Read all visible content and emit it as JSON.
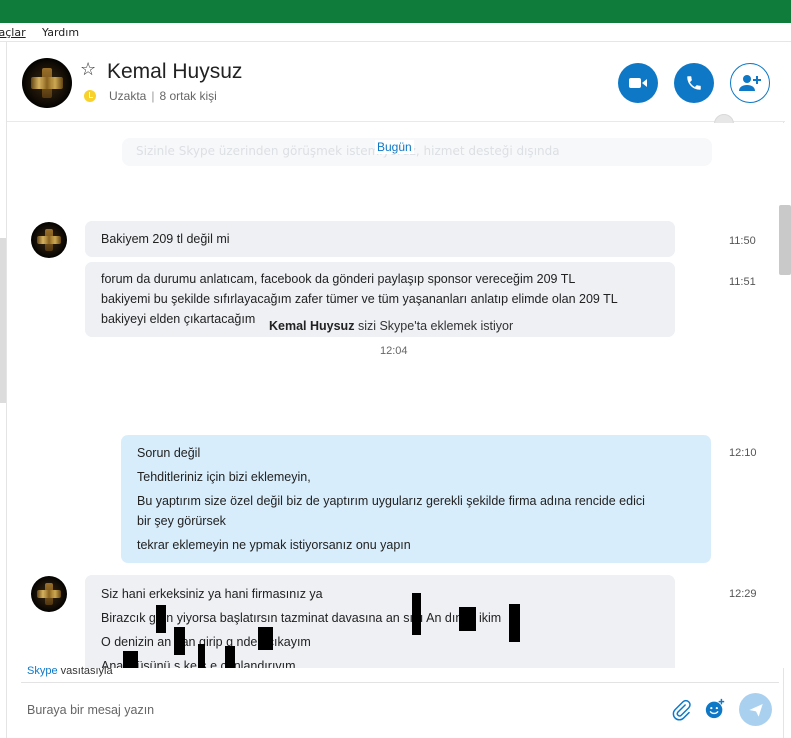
{
  "menu": {
    "item1": "raçlar",
    "item2": "Yardım"
  },
  "header": {
    "contact_name": "Kemal Huysuz",
    "status": "Uzakta",
    "mutual": "8 ortak kişi"
  },
  "chat": {
    "ghost_text": "Sizinle Skype üzerinden görüşmek istemiyoruz, hizmet desteği dışında",
    "today_label": "Bugün",
    "messages": [
      {
        "id": "m1",
        "text": "Bakiyem 209 tl değil mi",
        "time": "11:50"
      },
      {
        "id": "m2",
        "lines": [
          "forum da durumu anlatıcam, facebook da gönderi paylaşıp sponsor vereceğim 209 TL",
          "bakiyemi bu şekilde sıfırlayacağım zafer tümer ve tüm yaşananları anlatıp elimde olan 209 TL",
          "bakiyeyi elden çıkartacağım"
        ],
        "time": "11:51"
      },
      {
        "id": "m4",
        "lines": [
          "Sorun değil",
          "Tehditleriniz için bizi eklemeyin,",
          "Bu yaptırım size özel değil biz de yaptırım uygularız gerekli şekilde firma adına rencide edici",
          "bir şey görürsek",
          "tekrar eklemeyin ne ypmak istiyorsanız onu yapın"
        ],
        "time": "12:10"
      },
      {
        "id": "m5",
        "lines": [
          "Siz hani erkeksiniz ya hani firmasınız ya",
          "Birazcık g    ün yiyorsa başlatırsın tazminat davasına an    sını An    dını s   ikim",
          "O denizin an    dan girip g      nden çıkayım",
          "Ana    ölüsünü s  ke s   e canlandırıvım"
        ],
        "time": "12:29"
      }
    ],
    "system": {
      "name": "Kemal Huysuz",
      "text": "sizi Skype'ta eklemek istiyor",
      "time": "12:04"
    }
  },
  "footer": {
    "via_brand": "Skype",
    "via_text": "vasıtasıyla",
    "compose_placeholder": "Buraya bir mesaj yazın"
  },
  "colors": {
    "accent": "#0e78c6",
    "titlebar": "#107c3c",
    "incoming_bubble": "#eef0f4",
    "outgoing_bubble": "#d8edfb",
    "away": "#f8d22a"
  }
}
